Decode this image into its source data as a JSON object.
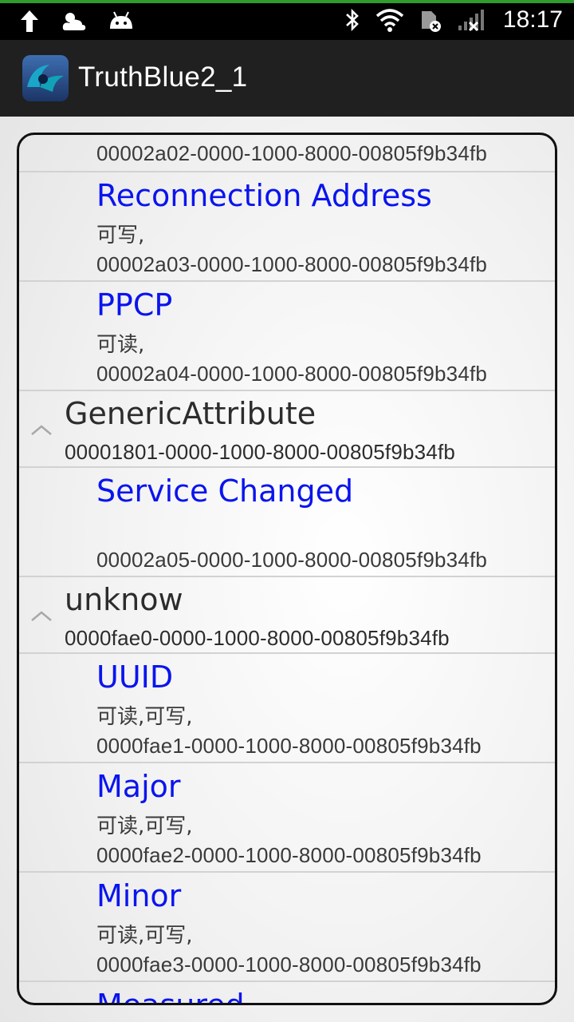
{
  "status_bar": {
    "time": "18:17",
    "left_icons": [
      "upload-arrow-icon",
      "weather-cloud-icon",
      "android-debug-icon"
    ],
    "right_icons": [
      "bluetooth-icon",
      "wifi-icon",
      "sim-error-icon",
      "signal-no-service-icon"
    ]
  },
  "action_bar": {
    "title": "TruthBlue2_1",
    "icon": "truthblue-app-icon"
  },
  "list": {
    "top_partial": {
      "uuid": "00002a02-0000-1000-8000-00805f9b34fb"
    },
    "items": [
      {
        "type": "characteristic",
        "name": "Reconnection Address",
        "props": "可写,",
        "uuid": "00002a03-0000-1000-8000-00805f9b34fb"
      },
      {
        "type": "characteristic",
        "name": "PPCP",
        "props": "可读,",
        "uuid": "00002a04-0000-1000-8000-00805f9b34fb"
      },
      {
        "type": "service",
        "name": "GenericAttribute",
        "uuid": "00001801-0000-1000-8000-00805f9b34fb",
        "expanded_icon": "chevron-up-icon"
      },
      {
        "type": "characteristic",
        "name": "Service Changed",
        "props": "",
        "uuid": "00002a05-0000-1000-8000-00805f9b34fb"
      },
      {
        "type": "service",
        "name": "unknow",
        "uuid": "0000fae0-0000-1000-8000-00805f9b34fb",
        "expanded_icon": "chevron-up-icon"
      },
      {
        "type": "characteristic",
        "name": "UUID",
        "props": "可读,可写,",
        "uuid": "0000fae1-0000-1000-8000-00805f9b34fb"
      },
      {
        "type": "characteristic",
        "name": "Major",
        "props": "可读,可写,",
        "uuid": "0000fae2-0000-1000-8000-00805f9b34fb"
      },
      {
        "type": "characteristic",
        "name": "Minor",
        "props": "可读,可写,",
        "uuid": "0000fae3-0000-1000-8000-00805f9b34fb"
      },
      {
        "type": "characteristic",
        "name": "Measured",
        "props": "",
        "uuid": ""
      }
    ]
  },
  "colors": {
    "characteristic_name": "#0a14ee",
    "text": "#3a3a3a",
    "action_bar": "#202020",
    "status_bar_accent": "#2e9c2e"
  }
}
